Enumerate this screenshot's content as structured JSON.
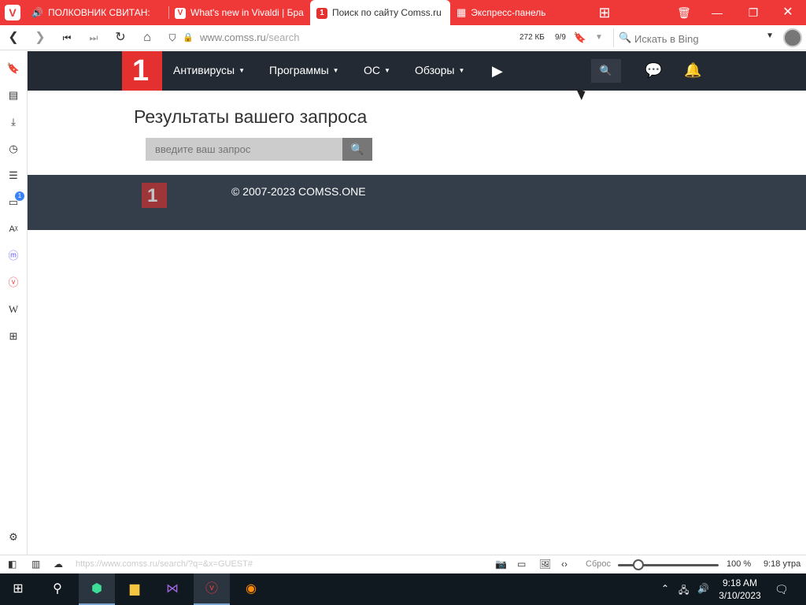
{
  "tabs": [
    {
      "label": "ПОЛКОВНИК СВИТАН: ",
      "icon": "speaker-icon"
    },
    {
      "label": "What's new in Vivaldi | Бра",
      "icon": "vivaldi-icon"
    },
    {
      "label": "Поиск по сайту Comss.ru",
      "icon": "comss-icon",
      "active": true
    },
    {
      "label": "Экспресс-панель",
      "icon": "grid-icon"
    }
  ],
  "address": {
    "host": "www.comss.ru",
    "path": "/search",
    "size": "272 КБ",
    "blocked": "9/9",
    "search_placeholder": "Искать в Bing"
  },
  "site": {
    "menu": [
      {
        "label": "Антивирусы"
      },
      {
        "label": "Программы"
      },
      {
        "label": "ОС"
      },
      {
        "label": "Обзоры"
      }
    ],
    "logo_text": "1",
    "result_title": "Результаты вашего запроса",
    "query_placeholder": "введите ваш запрос",
    "copyright": "© 2007-2023 COMSS.ONE"
  },
  "status": {
    "hover_url": "https://www.comss.ru/search/?q=&x=GUEST#",
    "reset_label": "Сброс",
    "zoom": "100 %",
    "zoom_level": 1.0,
    "time": "9:18 утра"
  },
  "side_panel": {
    "badge_count": "1"
  },
  "taskbar": {
    "time": "9:18 AM",
    "date": "3/10/2023"
  },
  "colors": {
    "tab_bar": "#ef3939",
    "site_header": "#242a33",
    "site_logo": "#e53030",
    "footer": "#343d4a"
  }
}
